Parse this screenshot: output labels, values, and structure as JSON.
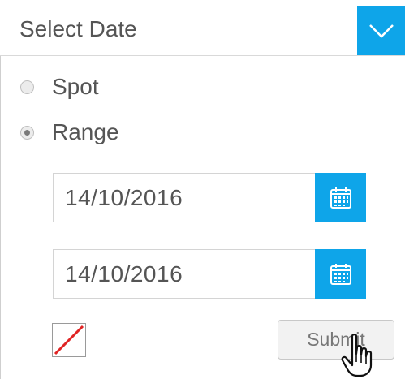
{
  "header": {
    "label": "Select Date",
    "toggle_icon": "chevron-down-icon",
    "accent": "#0ea5e9"
  },
  "mode": {
    "options": [
      {
        "label": "Spot",
        "selected": false
      },
      {
        "label": "Range",
        "selected": true
      }
    ]
  },
  "range": {
    "start": {
      "value": "14/10/2016",
      "icon": "calendar-icon"
    },
    "end": {
      "value": "14/10/2016",
      "icon": "calendar-icon"
    }
  },
  "actions": {
    "clear_icon": "clear-icon",
    "submit_label": "Submit",
    "cursor_icon": "hand-pointer-icon"
  }
}
